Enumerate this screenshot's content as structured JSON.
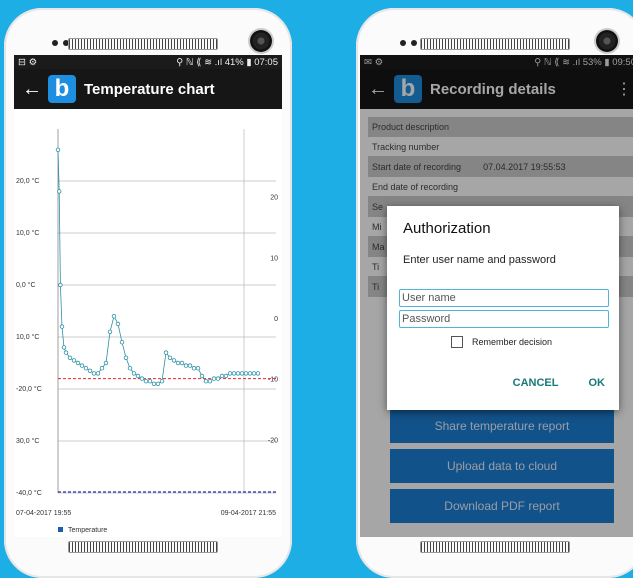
{
  "left_phone": {
    "status": {
      "left_icons": "⊟ ⚙",
      "right_text": "⚲ ℕ ⟪ ≋ .ıl 41% ▮ 07:05"
    },
    "appbar": {
      "back": "←",
      "logo_letter": "b",
      "title": "Temperature chart"
    }
  },
  "chart_data": {
    "type": "line",
    "title": "",
    "left_ticks": [
      "20,0 °C",
      "10,0 °C",
      "0,0 °C",
      "10,0 °C",
      "-20,0 °C",
      "30,0 °C",
      "-40,0 °C"
    ],
    "right_ticks": [
      "20",
      "10",
      "0",
      "-10",
      "-20"
    ],
    "x_start_label": "07-04-2017 19:55",
    "x_end_label": "09-04-2017 21:55",
    "ylim": [
      -40,
      30
    ],
    "upper_limit": -18,
    "lower_limit": -40,
    "series": [
      {
        "name": "Temperature",
        "color": "#2a8fa6",
        "x": [
          0,
          0.3,
          0.6,
          1.0,
          1.5,
          2,
          3,
          4,
          5,
          6,
          7,
          8,
          9,
          10,
          11,
          12,
          13,
          14,
          15,
          16,
          17,
          18,
          19,
          20,
          21,
          22,
          23,
          24,
          25,
          26,
          27,
          28,
          29,
          30,
          31,
          32,
          33,
          34,
          35,
          36,
          37,
          38,
          39,
          40,
          41,
          42,
          43,
          44,
          45,
          46,
          47,
          48,
          49,
          50
        ],
        "values": [
          26,
          18,
          0,
          -8,
          -12,
          -13,
          -14,
          -14.5,
          -15,
          -15.5,
          -16,
          -16.5,
          -17,
          -17,
          -16,
          -15,
          -9,
          -6,
          -7.5,
          -11,
          -14,
          -16,
          -17,
          -17.5,
          -18,
          -18.5,
          -18.5,
          -19,
          -19,
          -18.5,
          -13,
          -14,
          -14.5,
          -15,
          -15,
          -15.5,
          -15.5,
          -16,
          -16,
          -17.5,
          -18.5,
          -18.5,
          -18,
          -18,
          -17.5,
          -17.5,
          -17,
          -17,
          -17,
          -17,
          -17,
          -17,
          -17,
          -17
        ]
      }
    ],
    "legend": "bottom-left",
    "grid": true
  },
  "right_phone": {
    "status": {
      "left_icons": "✉ ⚙",
      "right_text": "⚲ ℕ ⟪ ≋ .ıl 53% ▮ 09:50"
    },
    "appbar": {
      "back": "←",
      "logo_letter": "b",
      "title": "Recording details",
      "menu": "⋮"
    },
    "rows": [
      {
        "label": "Product description",
        "value": ""
      },
      {
        "label": "Tracking number",
        "value": ""
      },
      {
        "label": "Start date of recording",
        "value": "07.04.2017 19:55:53"
      },
      {
        "label": "End date of recording",
        "value": ""
      },
      {
        "label": "Se",
        "value": ""
      },
      {
        "label": "Mi",
        "value": ""
      },
      {
        "label": "Ma",
        "value": ""
      },
      {
        "label": "Ti",
        "value": ""
      },
      {
        "label": "Ti",
        "value": ""
      }
    ],
    "buttons": {
      "share": "Share temperature report",
      "upload": "Upload data to cloud",
      "download": "Download PDF report"
    },
    "dialog": {
      "title": "Authorization",
      "message": "Enter user name and password",
      "username_placeholder": "User name",
      "password_placeholder": "Password",
      "remember": "Remember decision",
      "cancel": "CANCEL",
      "ok": "OK"
    }
  }
}
